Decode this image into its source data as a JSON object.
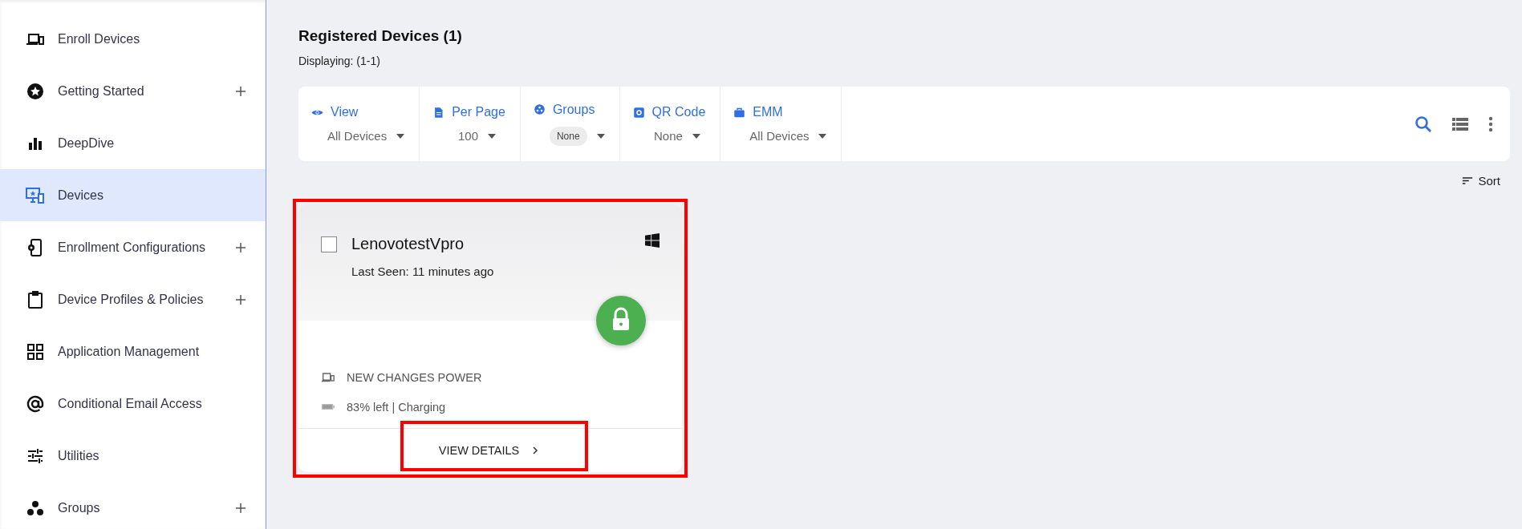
{
  "sidebar": {
    "items": [
      {
        "label": "Enroll Devices",
        "expandable": false,
        "selected": false
      },
      {
        "label": "Getting Started",
        "expandable": true,
        "selected": false
      },
      {
        "label": "DeepDive",
        "expandable": false,
        "selected": false
      },
      {
        "label": "Devices",
        "expandable": false,
        "selected": true
      },
      {
        "label": "Enrollment Configurations",
        "expandable": true,
        "selected": false
      },
      {
        "label": "Device Profiles & Policies",
        "expandable": true,
        "selected": false
      },
      {
        "label": "Application Management",
        "expandable": false,
        "selected": false
      },
      {
        "label": "Conditional Email Access",
        "expandable": false,
        "selected": false
      },
      {
        "label": "Utilities",
        "expandable": false,
        "selected": false
      },
      {
        "label": "Groups",
        "expandable": true,
        "selected": false
      }
    ]
  },
  "header": {
    "title": "Registered Devices (1)",
    "subtitle": "Displaying: (1-1)"
  },
  "toolbar": {
    "filters": [
      {
        "label": "View",
        "value": "All Devices",
        "kind": "text"
      },
      {
        "label": "Per Page",
        "value": "100",
        "kind": "text"
      },
      {
        "label": "Groups",
        "value": "None",
        "kind": "chip"
      },
      {
        "label": "QR Code",
        "value": "None",
        "kind": "text"
      },
      {
        "label": "EMM",
        "value": "All Devices",
        "kind": "text"
      }
    ],
    "sort": "Sort"
  },
  "device_card": {
    "name": "LenovotestVpro",
    "checked": false,
    "last_seen": "Last Seen: 11 minutes ago",
    "model": "NEW CHANGES POWER",
    "battery": "83% left | Charging",
    "action": "VIEW DETAILS"
  }
}
